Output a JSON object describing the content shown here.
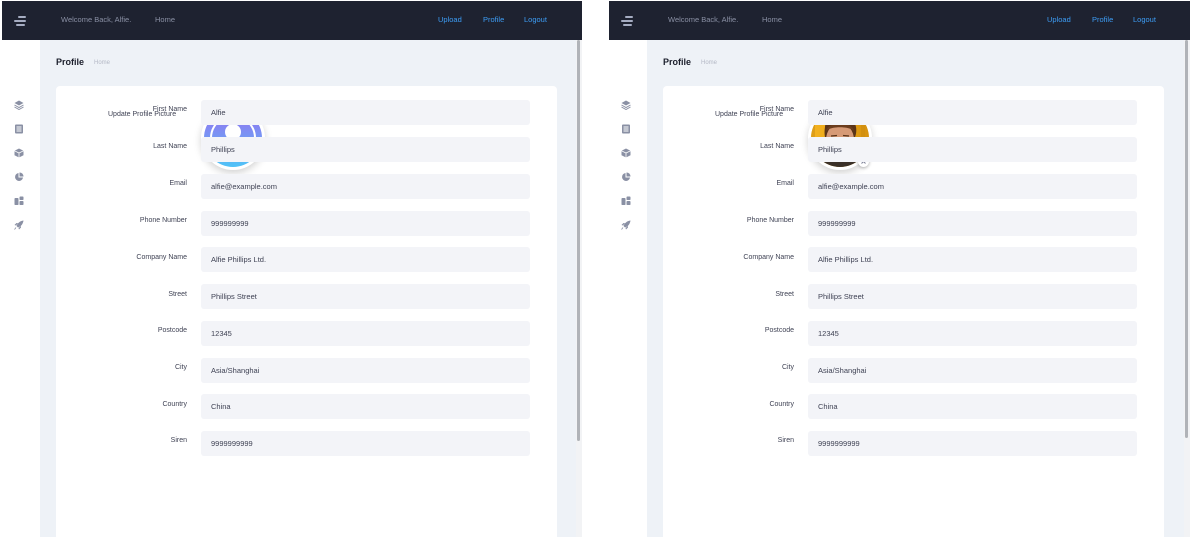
{
  "header": {
    "welcome": "Welcome Back, Alfie.",
    "home_link": "Home",
    "upload_link": "Upload",
    "profile_link": "Profile",
    "logout_link": "Logout"
  },
  "sidebar": {
    "icons": [
      "layers-icon",
      "list-icon",
      "box-icon",
      "pie-chart-icon",
      "layout-icon",
      "rocket-icon"
    ]
  },
  "page": {
    "title": "Profile",
    "breadcrumb": "Home"
  },
  "profile_picture": {
    "label": "Update Profile Picture"
  },
  "form": {
    "fields": [
      {
        "label": "First Name",
        "value": "Alfie"
      },
      {
        "label": "Last Name",
        "value": "Phillips"
      },
      {
        "label": "Email",
        "value": "alfie@example.com"
      },
      {
        "label": "Phone Number",
        "value": "999999999"
      },
      {
        "label": "Company Name",
        "value": "Alfie Phillips Ltd."
      },
      {
        "label": "Street",
        "value": "Phillips Street"
      },
      {
        "label": "Postcode",
        "value": "12345"
      },
      {
        "label": "City",
        "value": "Asia/Shanghai"
      },
      {
        "label": "Country",
        "value": "China"
      },
      {
        "label": "Siren",
        "value": "9999999999"
      }
    ]
  },
  "colors": {
    "topbar": "#1e2230",
    "accent_link": "#3d9df5",
    "page_bg": "#eef2f7",
    "input_bg": "#f3f4f8",
    "avatar_gradient_start": "#9b6cf0",
    "avatar_gradient_end": "#4fc3f7"
  }
}
